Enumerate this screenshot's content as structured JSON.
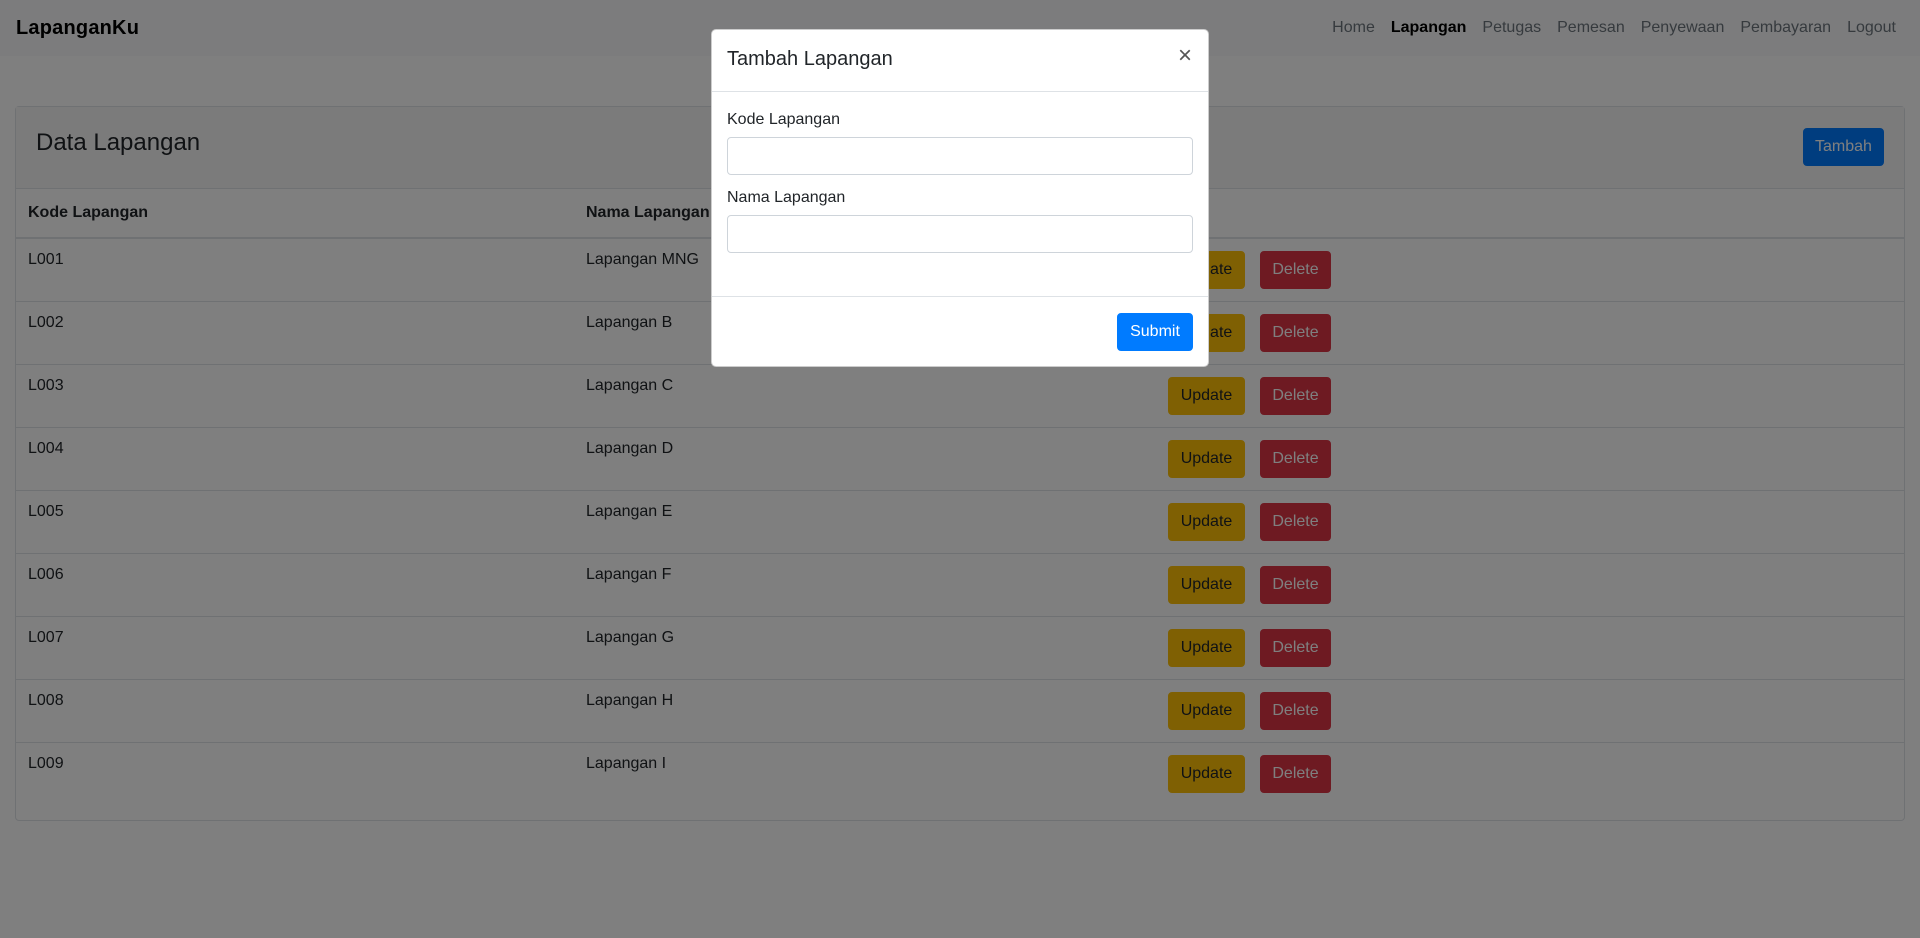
{
  "navbar": {
    "brand": "LapanganKu",
    "links": [
      {
        "label": "Home",
        "active": false
      },
      {
        "label": "Lapangan",
        "active": true
      },
      {
        "label": "Petugas",
        "active": false
      },
      {
        "label": "Pemesan",
        "active": false
      },
      {
        "label": "Penyewaan",
        "active": false
      },
      {
        "label": "Pembayaran",
        "active": false
      },
      {
        "label": "Logout",
        "active": false
      }
    ]
  },
  "card": {
    "title": "Data Lapangan",
    "add_button": "Tambah",
    "columns": [
      "Kode Lapangan",
      "Nama Lapangan"
    ],
    "rows": [
      {
        "kode": "L001",
        "nama": "Lapangan MNG"
      },
      {
        "kode": "L002",
        "nama": "Lapangan B"
      },
      {
        "kode": "L003",
        "nama": "Lapangan C"
      },
      {
        "kode": "L004",
        "nama": "Lapangan D"
      },
      {
        "kode": "L005",
        "nama": "Lapangan E"
      },
      {
        "kode": "L006",
        "nama": "Lapangan F"
      },
      {
        "kode": "L007",
        "nama": "Lapangan G"
      },
      {
        "kode": "L008",
        "nama": "Lapangan H"
      },
      {
        "kode": "L009",
        "nama": "Lapangan I"
      }
    ],
    "update_label": "Update",
    "delete_label": "Delete"
  },
  "modal": {
    "title": "Tambah Lapangan",
    "close_symbol": "×",
    "fields": [
      {
        "label": "Kode Lapangan",
        "value": ""
      },
      {
        "label": "Nama Lapangan",
        "value": ""
      }
    ],
    "submit_label": "Submit"
  },
  "colors": {
    "primary": "#007bff",
    "warning": "#ffc107",
    "danger": "#dc3545",
    "backdrop": "rgba(0,0,0,0.5)"
  }
}
